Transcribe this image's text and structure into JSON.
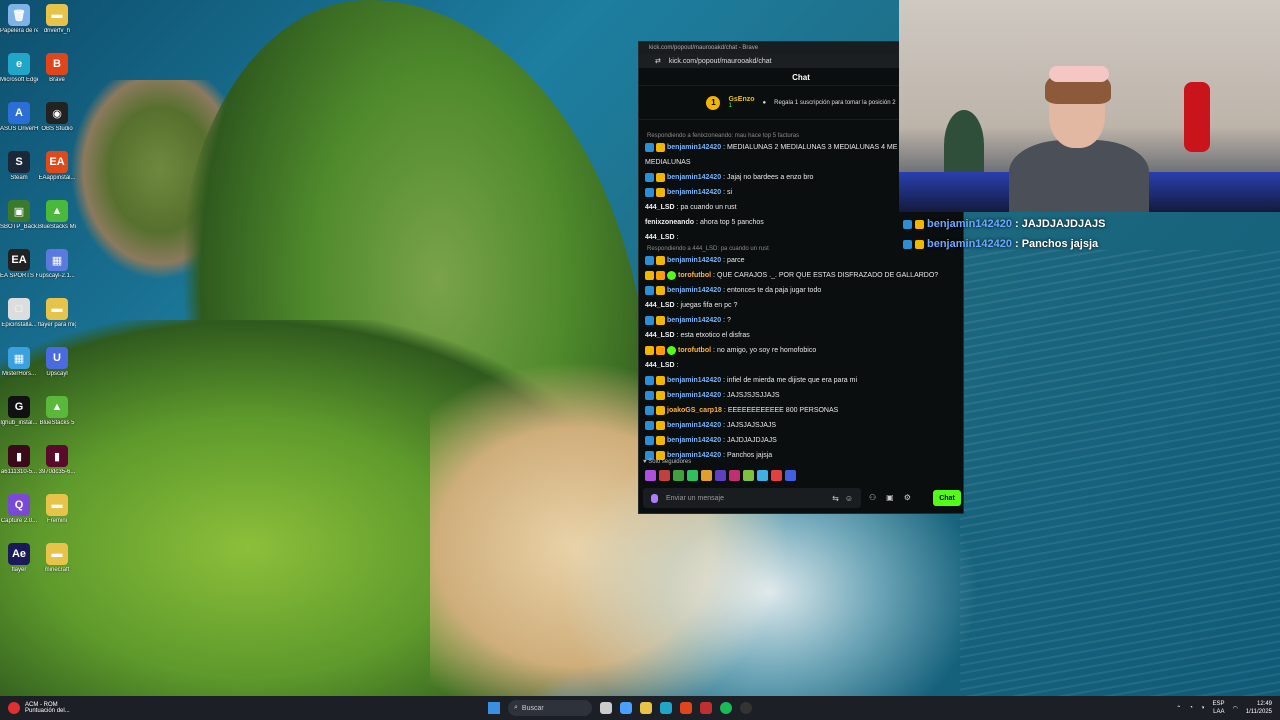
{
  "desktop": {
    "icons": [
      {
        "label": "Papelera de reciclaje",
        "color": "#7fb3e8",
        "glyph": "🗑",
        "col": 0,
        "row": 0
      },
      {
        "label": "Microsoft Edge",
        "color": "#1fa6c9",
        "glyph": "e",
        "col": 0,
        "row": 1
      },
      {
        "label": "ASUS DriverHub",
        "color": "#2b6fd6",
        "glyph": "A",
        "col": 0,
        "row": 2
      },
      {
        "label": "Steam",
        "color": "#1b2838",
        "glyph": "S",
        "col": 0,
        "row": 3
      },
      {
        "label": "SBOTP_Back...",
        "color": "#3a7a2a",
        "glyph": "▣",
        "col": 0,
        "row": 4
      },
      {
        "label": "EA SPORTS FC 25",
        "color": "#222",
        "glyph": "EA",
        "col": 0,
        "row": 5
      },
      {
        "label": "Epicinstalla...",
        "color": "#ddd",
        "glyph": "□",
        "col": 0,
        "row": 6
      },
      {
        "label": "MisterHors...",
        "color": "#3aa0e0",
        "glyph": "▦",
        "col": 0,
        "row": 7
      },
      {
        "label": "lghub_instal...",
        "color": "#111",
        "glyph": "G",
        "col": 0,
        "row": 8
      },
      {
        "label": "a6111310-5...",
        "color": "#3a0a1a",
        "glyph": "▮",
        "col": 0,
        "row": 9
      },
      {
        "label": "Capture 2.0...",
        "color": "#7a4ad6",
        "glyph": "Q",
        "col": 0,
        "row": 10
      },
      {
        "label": "flayer",
        "color": "#1a1a5a",
        "glyph": "Ae",
        "col": 0,
        "row": 11
      },
      {
        "label": "driverfv_h",
        "color": "#e8c34a",
        "glyph": "▬",
        "col": 1,
        "row": 0
      },
      {
        "label": "Brave",
        "color": "#e0461b",
        "glyph": "B",
        "col": 1,
        "row": 1
      },
      {
        "label": "OBS Studio",
        "color": "#222",
        "glyph": "◉",
        "col": 1,
        "row": 2
      },
      {
        "label": "EAappinstal...",
        "color": "#e04a1b",
        "glyph": "EA",
        "col": 1,
        "row": 3
      },
      {
        "label": "BlueStacks Multi-Insta...",
        "color": "#4ab83a",
        "glyph": "▲",
        "col": 1,
        "row": 4
      },
      {
        "label": "upscayl-2.1...",
        "color": "#5a7ae0",
        "glyph": "▦",
        "col": 1,
        "row": 5
      },
      {
        "label": "flayer para miguel",
        "color": "#e8c34a",
        "glyph": "▬",
        "col": 1,
        "row": 6
      },
      {
        "label": "Upscayl",
        "color": "#4a6ae0",
        "glyph": "U",
        "col": 1,
        "row": 7
      },
      {
        "label": "BlueStacks 5",
        "color": "#5ab83a",
        "glyph": "▲",
        "col": 1,
        "row": 8
      },
      {
        "label": "3970dc35-6...",
        "color": "#5a0a2a",
        "glyph": "▮",
        "col": 1,
        "row": 9
      },
      {
        "label": "Fremini",
        "color": "#e8c34a",
        "glyph": "▬",
        "col": 1,
        "row": 10
      },
      {
        "label": "minecraft",
        "color": "#e8c34a",
        "glyph": "▬",
        "col": 1,
        "row": 11
      }
    ]
  },
  "chat_window": {
    "title": "kick.com/popout/maurooakd/chat - Brave",
    "url": "kick.com/popout/maurooakd/chat",
    "header": "Chat",
    "pinned": {
      "gift_rank": "1",
      "gifter": "GsEnzo",
      "gifter_count": "1",
      "prompt": "Regala 1 suscripción para tomar la posición 2"
    },
    "messages": [
      {
        "reply": "Respondiendo a fenixzoneando: mau hace top 5 facturas"
      },
      {
        "badges": [
          "blue",
          "yellow"
        ],
        "user": "benjamin142420",
        "ucolor": "blue",
        "text": "MEDIALUNAS 2 MEDIALUNAS 3 MEDIALUNAS 4 ME"
      },
      {
        "badges": [],
        "user": "",
        "ucolor": "white",
        "text": "MEDIALUNAS"
      },
      {
        "badges": [
          "blue",
          "yellow"
        ],
        "user": "benjamin142420",
        "ucolor": "blue",
        "text": "Jajaj no bardees a enzo bro"
      },
      {
        "badges": [
          "blue",
          "yellow"
        ],
        "user": "benjamin142420",
        "ucolor": "blue",
        "text": "si"
      },
      {
        "badges": [],
        "user": "444_LSD",
        "ucolor": "white",
        "text": "pa cuando un rust"
      },
      {
        "badges": [],
        "user": "fenixzoneando",
        "ucolor": "white",
        "text": "ahora top 5 panchos"
      },
      {
        "badges": [],
        "user": "444_LSD",
        "ucolor": "white",
        "text": ""
      },
      {
        "reply": "Respondiendo a 444_LSD: pa cuando un rust"
      },
      {
        "badges": [
          "blue",
          "yellow"
        ],
        "user": "benjamin142420",
        "ucolor": "blue",
        "text": "parce"
      },
      {
        "badges": [
          "yellow",
          "orange",
          "green"
        ],
        "user": "torofutbol",
        "ucolor": "orange",
        "text": "QUE CARAJOS ._. POR QUE ESTAS DISFRAZADO DE GALLARDO?"
      },
      {
        "badges": [
          "blue",
          "yellow"
        ],
        "user": "benjamin142420",
        "ucolor": "blue",
        "text": "entonces te da paja jugar todo"
      },
      {
        "badges": [],
        "user": "444_LSD",
        "ucolor": "white",
        "text": "juegas fifa en pc ?"
      },
      {
        "badges": [
          "blue",
          "yellow"
        ],
        "user": "benjamin142420",
        "ucolor": "blue",
        "text": "?"
      },
      {
        "badges": [],
        "user": "444_LSD",
        "ucolor": "white",
        "text": "esta etxotico el disfras"
      },
      {
        "badges": [
          "yellow",
          "orange",
          "green"
        ],
        "user": "torofutbol",
        "ucolor": "orange",
        "text": "no amigo, yo soy re homofobico"
      },
      {
        "badges": [],
        "user": "444_LSD",
        "ucolor": "white",
        "text": ""
      },
      {
        "badges": [
          "blue",
          "yellow"
        ],
        "user": "benjamin142420",
        "ucolor": "blue",
        "text": "infiel de mierda me dijiste que era para mi"
      },
      {
        "badges": [
          "blue",
          "yellow"
        ],
        "user": "benjamin142420",
        "ucolor": "blue",
        "text": "JAJSJSJSJJAJS"
      },
      {
        "badges": [
          "blue",
          "yellow"
        ],
        "user": "joakoGS_carp18",
        "ucolor": "orange",
        "text": "EEEEEEEEEEEE 800 PERSONAS"
      },
      {
        "badges": [
          "blue",
          "yellow"
        ],
        "user": "benjamin142420",
        "ucolor": "blue",
        "text": "JAJSJAJSJAJS"
      },
      {
        "badges": [
          "blue",
          "yellow"
        ],
        "user": "benjamin142420",
        "ucolor": "blue",
        "text": "JAJDJAJDJAJS"
      },
      {
        "badges": [
          "blue",
          "yellow"
        ],
        "user": "benjamin142420",
        "ucolor": "blue",
        "text": "Panchos jajsja"
      }
    ],
    "followers_only": "Solo seguidores",
    "input_placeholder": "Enviar un mensaje",
    "send_label": "Chat"
  },
  "overlay": {
    "lines": [
      {
        "user": "benjamin142420",
        "text": ": JAJDJAJDJAJS"
      },
      {
        "user": "benjamin142420",
        "text": ": Panchos jajsja"
      }
    ]
  },
  "taskbar": {
    "now_playing_title": "ACM - ROM",
    "now_playing_sub": "Puntuación del...",
    "search_placeholder": "Buscar",
    "lang": "ESP",
    "lang_sub": "LAA",
    "time": "12:49",
    "date": "1/11/2025"
  },
  "colors": {
    "kick_green": "#53fc18",
    "user_blue": "#74b5ff",
    "chat_bg": "#0b0e0f"
  }
}
